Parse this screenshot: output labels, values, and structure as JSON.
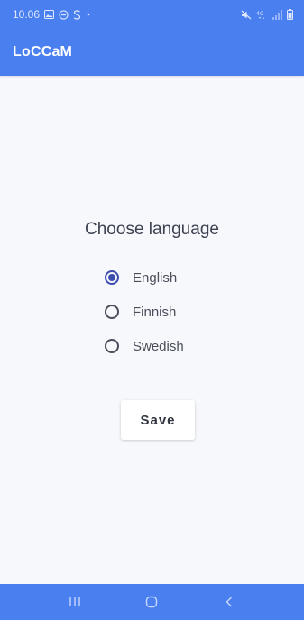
{
  "status_bar": {
    "time": "10.06",
    "left_icons": [
      "gallery-icon",
      "do-not-disturb-icon",
      "s-app-icon",
      "dot-icon"
    ],
    "right_icons": [
      "mute-icon",
      "4g-icon",
      "signal-icon",
      "battery-icon"
    ],
    "network_label": "4G"
  },
  "app_bar": {
    "title": "LoCCaM"
  },
  "language_form": {
    "heading": "Choose language",
    "options": [
      {
        "label": "English",
        "selected": true
      },
      {
        "label": "Finnish",
        "selected": false
      },
      {
        "label": "Swedish",
        "selected": false
      }
    ],
    "save_label": "Save"
  },
  "nav_bar": {
    "buttons": [
      "recent-apps-icon",
      "home-icon",
      "back-icon"
    ]
  },
  "colors": {
    "primary": "#4a7ff0",
    "background": "#f7f8fc",
    "radio_selected": "#3b4eb0",
    "text": "#3d4250"
  }
}
